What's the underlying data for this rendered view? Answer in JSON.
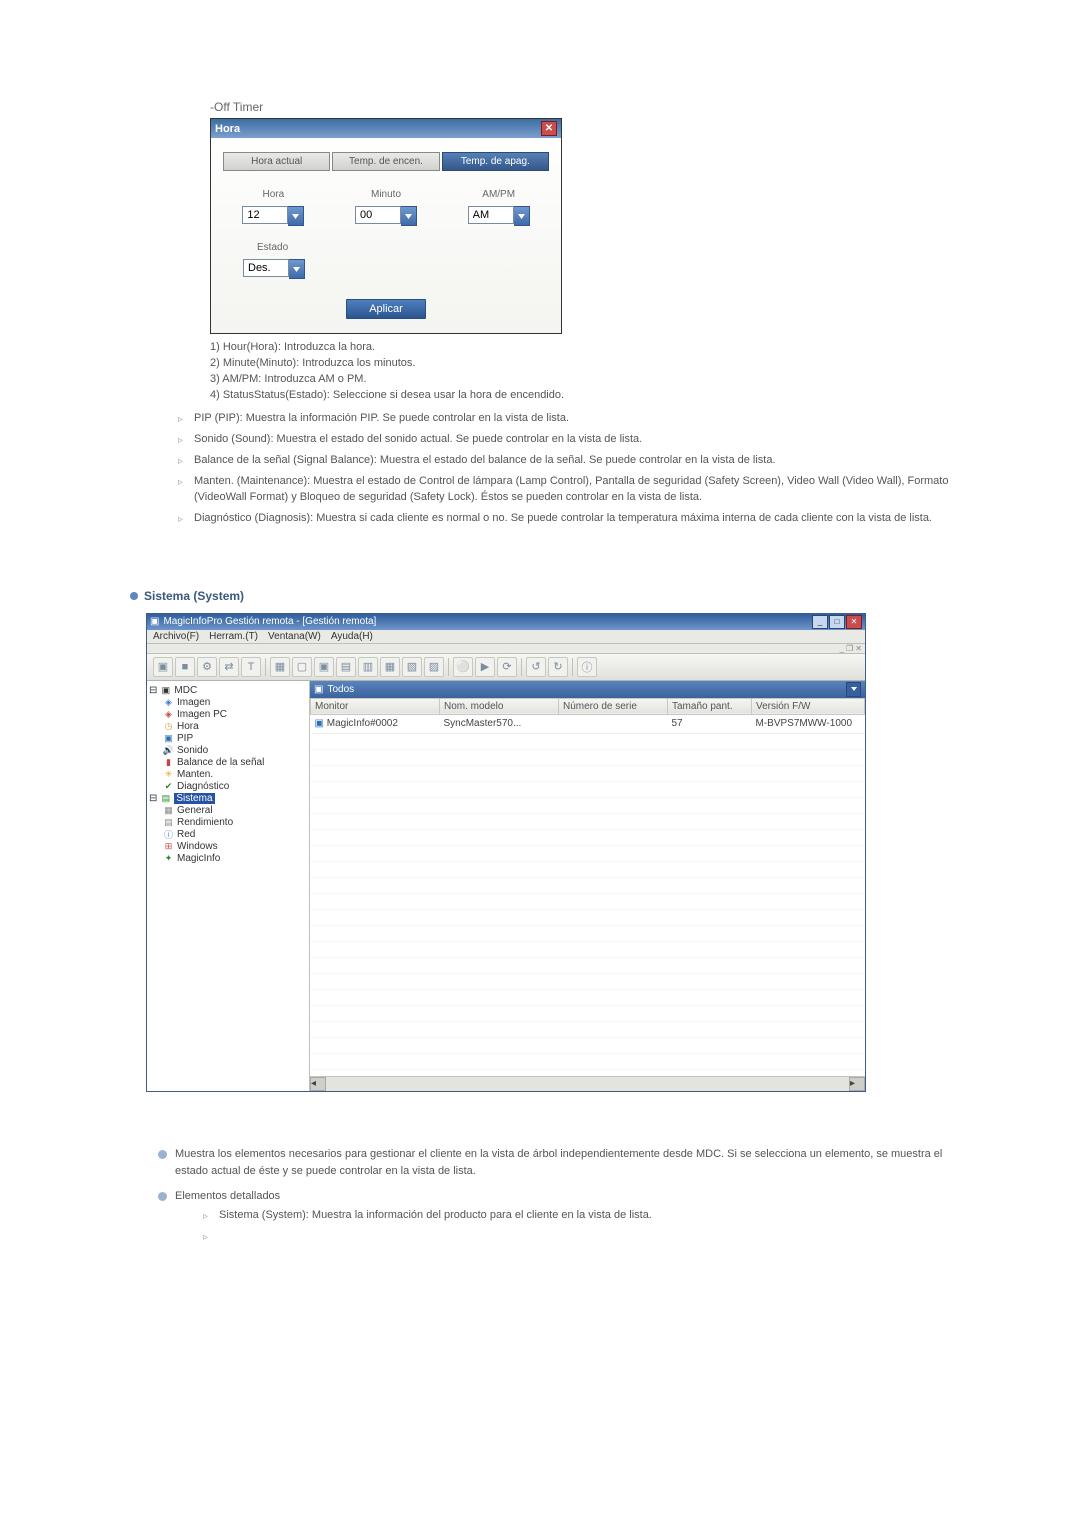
{
  "offTimer": {
    "label": "-Off Timer"
  },
  "dialog": {
    "title": "Hora",
    "tabs": [
      "Hora actual",
      "Temp. de encen.",
      "Temp. de apag."
    ],
    "columns": {
      "hour": "Hora",
      "minute": "Minuto",
      "ampm": "AM/PM"
    },
    "values": {
      "hour": "12",
      "minute": "00",
      "ampm": "AM"
    },
    "state_label": "Estado",
    "state_value": "Des.",
    "apply": "Aplicar"
  },
  "notes": [
    "1) Hour(Hora): Introduzca la hora.",
    "2) Minute(Minuto): Introduzca los minutos.",
    "3) AM/PM: Introduzca AM o PM.",
    "4) StatusStatus(Estado): Seleccione si desea usar la hora de encendido."
  ],
  "bullets": [
    "PIP (PIP): Muestra la información PIP. Se puede controlar en la vista de lista.",
    "Sonido (Sound): Muestra el estado del sonido actual. Se puede controlar en la vista de lista.",
    "Balance de la señal (Signal Balance): Muestra el estado del balance de la señal. Se puede controlar en la vista de lista.",
    "Manten. (Maintenance): Muestra el estado de Control de lámpara (Lamp Control), Pantalla de seguridad (Safety Screen), Video Wall (Video Wall), Formato (VideoWall Format) y Bloqueo de seguridad (Safety Lock). Éstos se pueden controlar en la vista de lista.",
    "Diagnóstico (Diagnosis): Muestra si cada cliente es normal o no. Se puede controlar la temperatura máxima interna de cada cliente con la vista de lista."
  ],
  "section": {
    "title": "Sistema (System)"
  },
  "app": {
    "title": "MagicInfoPro Gestión remota - [Gestión remota]",
    "menus": [
      "Archivo(F)",
      "Herram.(T)",
      "Ventana(W)",
      "Ayuda(H)"
    ],
    "toolbar_glyphs": [
      "▣",
      "■",
      "⚙",
      "⇄",
      "T",
      "",
      "▦",
      "▢",
      "▣",
      "▤",
      "▥",
      "▦",
      "▧",
      "▨",
      "⚪",
      "▶",
      "⟳",
      "↺",
      "↻",
      "",
      "ⓘ"
    ],
    "tree": {
      "root": "MDC",
      "mdc_children": [
        "Imagen",
        "Imagen PC",
        "Hora",
        "PIP",
        "Sonido",
        "Balance de la señal",
        "Manten.",
        "Diagnóstico"
      ],
      "sistema": "Sistema",
      "sistema_children": [
        "General",
        "Rendimiento",
        "Red",
        "Windows",
        "MagicInfo"
      ]
    },
    "grid": {
      "header": "Todos",
      "cols": [
        "Monitor",
        "Nom. modelo",
        "Número de serie",
        "Tamaño pant.",
        "Versión F/W"
      ],
      "row": {
        "monitor": "MagicInfo#0002",
        "model": "SyncMaster570...",
        "serial": "",
        "size": "57",
        "fw": "M-BVPS7MWW-1000"
      }
    }
  },
  "bodyNotes": {
    "p1": "Muestra los elementos necesarios para gestionar el cliente en la vista de árbol independientemente desde MDC. Si se selecciona un elemento, se muestra el estado actual de éste y se puede controlar en la vista de lista.",
    "p2": "Elementos detallados",
    "sub1": "Sistema (System): Muestra la información del producto para el cliente en la vista de lista."
  }
}
